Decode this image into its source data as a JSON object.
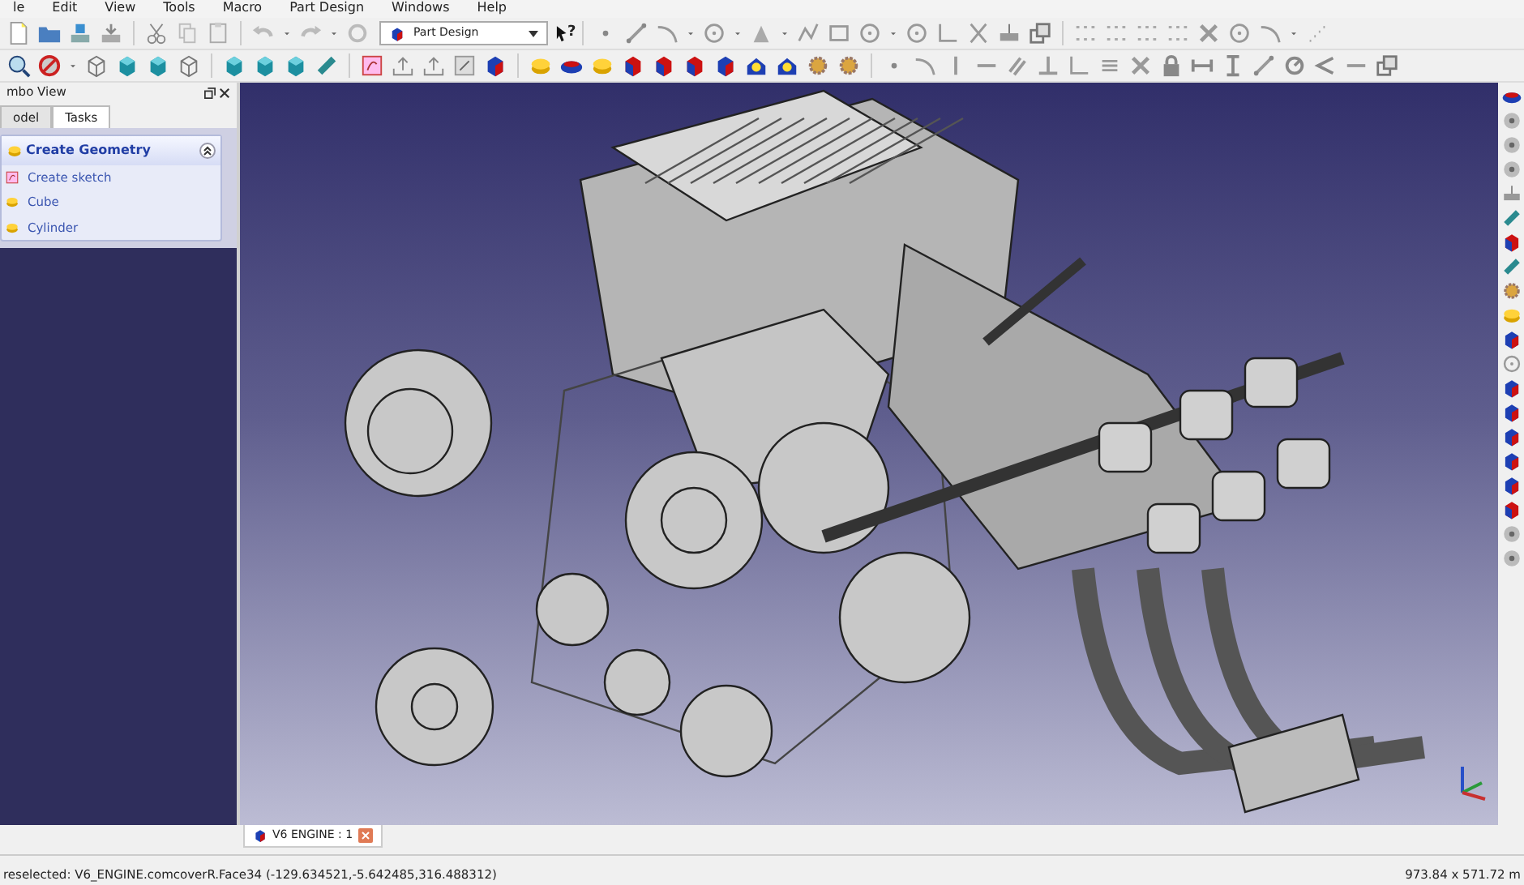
{
  "menu": [
    {
      "label": "le"
    },
    {
      "label": "Edit"
    },
    {
      "label": "View"
    },
    {
      "label": "Tools"
    },
    {
      "label": "Macro"
    },
    {
      "label": "Part Design"
    },
    {
      "label": "Windows"
    },
    {
      "label": "Help"
    }
  ],
  "workbench_selector": {
    "value": "Part Design"
  },
  "whats_this_button": {
    "text": "?"
  },
  "combo_view": {
    "title": "mbo View",
    "tabs": [
      {
        "label": "odel",
        "selected": false
      },
      {
        "label": "Tasks",
        "selected": true
      }
    ],
    "task_panel": {
      "title": "Create Geometry",
      "expanded": true,
      "items": [
        {
          "label": "Create sketch"
        },
        {
          "label": "Cube"
        },
        {
          "label": "Cylinder"
        }
      ]
    }
  },
  "document_tabs": [
    {
      "label": "V6 ENGINE : 1",
      "selected": true
    }
  ],
  "status_bar": {
    "message": "reselected: V6_ENGINE.comcoverR.Face34 (-129.634521,-5.642485,316.488312)",
    "dimensions": "973.84 x 571.72 m"
  }
}
